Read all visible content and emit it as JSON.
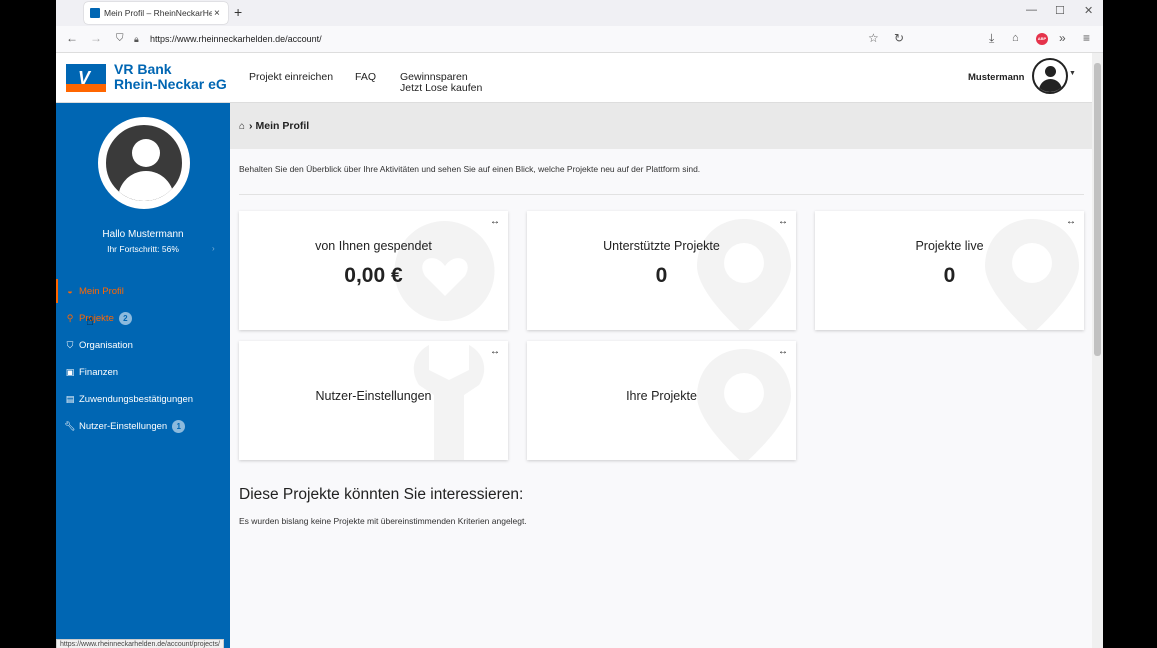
{
  "browser": {
    "tab_title": "Mein Profil – RheinNeckarHelden",
    "tab_close": "×",
    "new_tab": "+",
    "url": "https://www.rheinneckarhelden.de/account/",
    "status_url": "https://www.rheinneckarhelden.de/account/projects/"
  },
  "header": {
    "logo_line1": "VR Bank",
    "logo_line2": "Rhein-Neckar eG",
    "nav": [
      {
        "label": "Projekt einreichen"
      },
      {
        "label": "FAQ"
      },
      {
        "label_line1": "Gewinnsparen",
        "label_line2": "Jetzt Lose kaufen"
      }
    ],
    "user_name": "Mustermann"
  },
  "sidebar": {
    "greeting": "Hallo Mustermann",
    "progress": "Ihr Fortschritt: 56%",
    "items": [
      {
        "label": "Mein Profil",
        "icon": "dashboard-icon"
      },
      {
        "label": "Projekte",
        "icon": "pin-icon",
        "badge": "2"
      },
      {
        "label": "Organisation",
        "icon": "shield-icon"
      },
      {
        "label": "Finanzen",
        "icon": "money-icon"
      },
      {
        "label": "Zuwendungsbestätigungen",
        "icon": "document-icon"
      },
      {
        "label": "Nutzer-Einstellungen",
        "icon": "wrench-icon",
        "badge": "1"
      }
    ]
  },
  "breadcrumb": {
    "label": "Mein Profil"
  },
  "intro": "Behalten Sie den Überblick über Ihre Aktivitäten und sehen Sie auf einen Blick, welche Projekte neu auf der Plattform sind.",
  "cards": [
    {
      "label": "von Ihnen gespendet",
      "value": "0,00 €"
    },
    {
      "label": "Unterstützte Projekte",
      "value": "0"
    },
    {
      "label": "Projekte live",
      "value": "0"
    },
    {
      "label": "Nutzer-Einstellungen"
    },
    {
      "label": "Ihre Projekte"
    }
  ],
  "interest": {
    "title": "Diese Projekte könnten Sie interessieren:",
    "text": "Es wurden bislang keine Projekte mit übereinstimmenden Kriterien angelegt."
  },
  "colors": {
    "brand_blue": "#0066b3",
    "brand_orange": "#ff6600"
  }
}
